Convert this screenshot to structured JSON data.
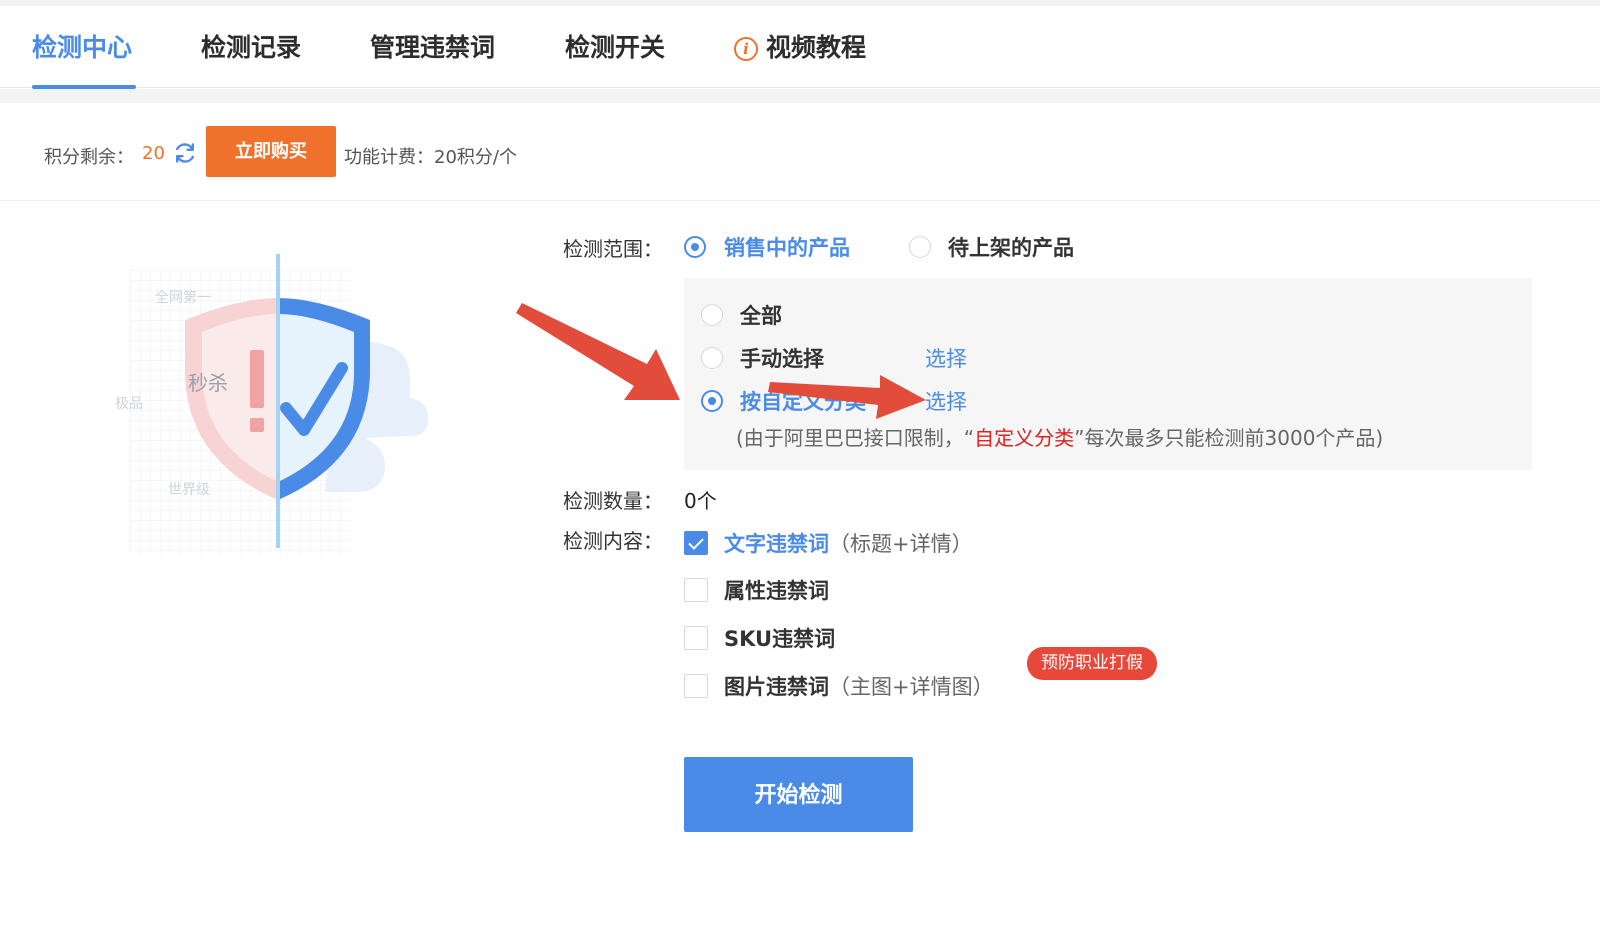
{
  "tabs": [
    {
      "label": "检测中心",
      "active": true
    },
    {
      "label": "检测记录",
      "active": false
    },
    {
      "label": "管理违禁词",
      "active": false
    },
    {
      "label": "检测开关",
      "active": false
    },
    {
      "label": "视频教程",
      "active": false,
      "icon": "info-icon"
    }
  ],
  "points": {
    "label": "积分剩余：",
    "value": "20",
    "buy_label": "立即购买",
    "fee_label": "功能计费：20积分/个"
  },
  "illustration": {
    "tag_top": "全网第一",
    "tag_left": "极品",
    "tag_mid": "秒杀",
    "tag_bottom": "世界级"
  },
  "scope": {
    "label": "检测范围：",
    "options": [
      {
        "label": "销售中的产品",
        "selected": true
      },
      {
        "label": "待上架的产品",
        "selected": false
      }
    ],
    "sub_options": [
      {
        "label": "全部",
        "selected": false
      },
      {
        "label": "手动选择",
        "selected": false,
        "link": "选择"
      },
      {
        "label": "按自定义分类",
        "selected": true,
        "link": "选择"
      }
    ],
    "note_prefix": "(由于阿里巴巴接口限制，“",
    "note_highlight": "自定义分类",
    "note_suffix": "”每次最多只能检测前3000个产品)"
  },
  "count": {
    "label": "检测数量：",
    "value": "0个"
  },
  "content": {
    "label": "检测内容：",
    "items": [
      {
        "label": "文字违禁词",
        "hint": "（标题+详情）",
        "checked": true
      },
      {
        "label": "属性违禁词",
        "hint": "",
        "checked": false
      },
      {
        "label": "SKU违禁词",
        "hint": "",
        "checked": false
      },
      {
        "label": "图片违禁词",
        "hint": "（主图+详情图）",
        "checked": false
      }
    ],
    "badge": "预防职业打假"
  },
  "start_label": "开始检测",
  "colors": {
    "accent": "#4a8be8",
    "orange": "#f0712c",
    "red": "#e02020",
    "arrow": "#e24c3b"
  }
}
